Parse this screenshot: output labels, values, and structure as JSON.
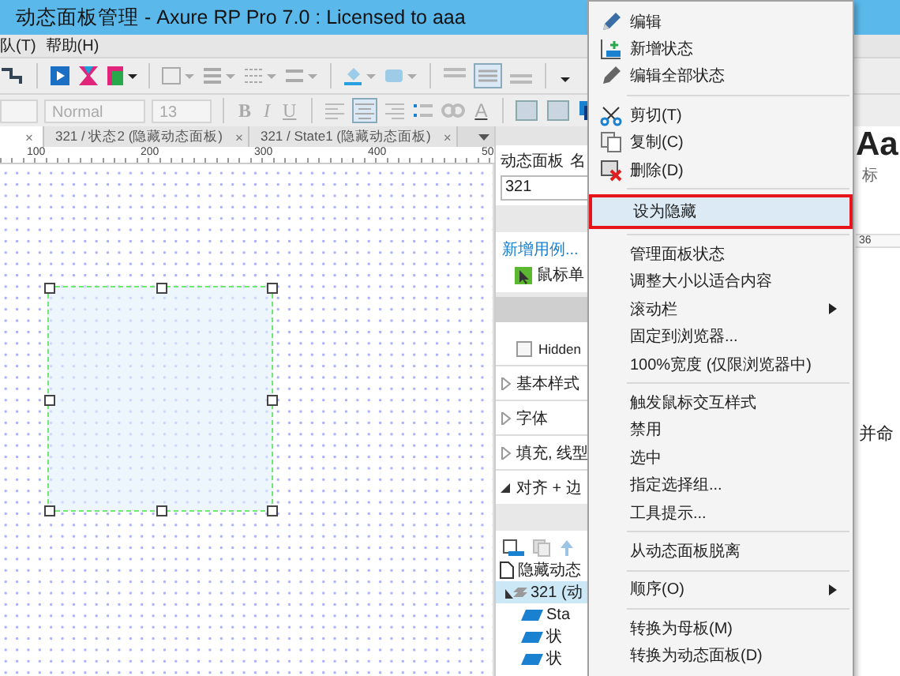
{
  "window": {
    "title": "动态面板管理 - Axure RP Pro 7.0 : Licensed to aaa"
  },
  "menu_bar": [
    "队(T)",
    "帮助(H)"
  ],
  "toolbar": {
    "style_value": "Normal",
    "size_value": "13",
    "bold": "B",
    "italic": "I",
    "underline": "U",
    "font_color": "A"
  },
  "tabs": [
    {
      "close": "×",
      "selected": true
    },
    {
      "label": "321 / 状态2 (隐藏动态面板)",
      "close": "×",
      "selected": false
    },
    {
      "label": "321 / State1 (隐藏动态面板)",
      "close": "×",
      "selected": false
    }
  ],
  "ruler": [
    "100",
    "200",
    "300",
    "400",
    "50"
  ],
  "canvas": {
    "widget": {
      "selected": true
    }
  },
  "inspector": {
    "heading": "动态面板",
    "name_label": "名",
    "name_value": "321",
    "add_case": "新增用例...",
    "case": "鼠标单",
    "hidden": {
      "label": "Hidden",
      "checked": false
    },
    "sections": [
      {
        "label": "基本样式",
        "expanded": false
      },
      {
        "label": "字体",
        "expanded": false
      },
      {
        "label": "填充, 线型",
        "expanded": false
      },
      {
        "label": "对齐 + 边",
        "expanded": true
      }
    ]
  },
  "outline": [
    {
      "label": "隐藏动态",
      "kind": "page",
      "selected": false,
      "children": [
        {
          "label": "321 (动",
          "kind": "panel",
          "selected": true,
          "expanded": true,
          "children": [
            {
              "label": "Sta",
              "kind": "state",
              "selected": false
            },
            {
              "label": "状",
              "kind": "state",
              "selected": false
            },
            {
              "label": "状",
              "kind": "state",
              "selected": false
            }
          ]
        }
      ]
    }
  ],
  "right_strip": {
    "sample": "Aa",
    "label": "标",
    "ruler": "36",
    "text": "并命"
  },
  "context_menu": [
    {
      "kind": "item",
      "label": "编辑",
      "selected": false,
      "submenu": false
    },
    {
      "kind": "item",
      "label": "新增状态",
      "selected": false,
      "submenu": false
    },
    {
      "kind": "item",
      "label": "编辑全部状态",
      "selected": false,
      "submenu": false
    },
    {
      "kind": "separator"
    },
    {
      "kind": "item",
      "label": "剪切(T)",
      "selected": false,
      "submenu": false
    },
    {
      "kind": "item",
      "label": "复制(C)",
      "selected": false,
      "submenu": false
    },
    {
      "kind": "item",
      "label": "删除(D)",
      "selected": false,
      "submenu": false
    },
    {
      "kind": "separator"
    },
    {
      "kind": "item",
      "label": "设为隐藏",
      "selected": true,
      "submenu": false
    },
    {
      "kind": "separator"
    },
    {
      "kind": "item",
      "label": "管理面板状态",
      "selected": false,
      "submenu": false
    },
    {
      "kind": "item",
      "label": "调整大小以适合内容",
      "selected": false,
      "submenu": false
    },
    {
      "kind": "item",
      "label": "滚动栏",
      "selected": false,
      "submenu": true
    },
    {
      "kind": "item",
      "label": "固定到浏览器...",
      "selected": false,
      "submenu": false
    },
    {
      "kind": "item",
      "label": "100%宽度 (仅限浏览器中)",
      "selected": false,
      "submenu": false
    },
    {
      "kind": "separator"
    },
    {
      "kind": "item",
      "label": "触发鼠标交互样式",
      "selected": false,
      "submenu": false
    },
    {
      "kind": "item",
      "label": "禁用",
      "selected": false,
      "submenu": false
    },
    {
      "kind": "item",
      "label": "选中",
      "selected": false,
      "submenu": false
    },
    {
      "kind": "item",
      "label": "指定选择组...",
      "selected": false,
      "submenu": false
    },
    {
      "kind": "item",
      "label": "工具提示...",
      "selected": false,
      "submenu": false
    },
    {
      "kind": "separator"
    },
    {
      "kind": "item",
      "label": "从动态面板脱离",
      "selected": false,
      "submenu": false
    },
    {
      "kind": "separator"
    },
    {
      "kind": "item",
      "label": "顺序(O)",
      "selected": false,
      "submenu": true
    },
    {
      "kind": "separator"
    },
    {
      "kind": "item",
      "label": "转换为母板(M)",
      "selected": false,
      "submenu": false
    },
    {
      "kind": "item",
      "label": "转换为动态面板(D)",
      "selected": false,
      "submenu": false
    }
  ]
}
